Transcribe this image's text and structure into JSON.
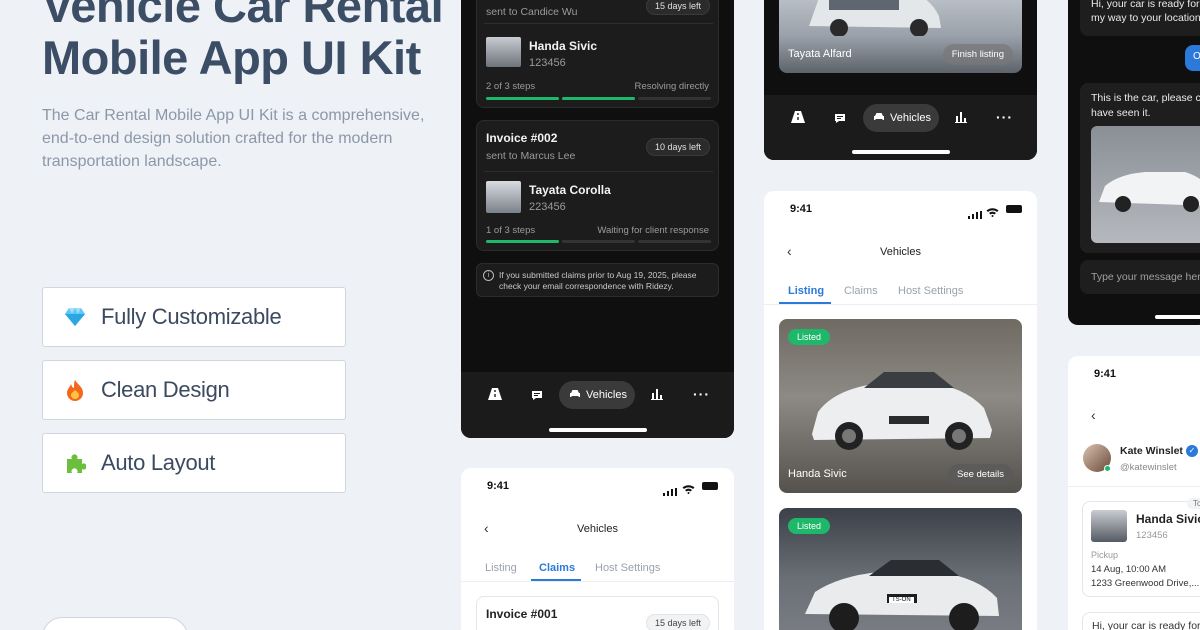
{
  "hero": {
    "title": "Vehicle Car Rental Mobile App UI Kit",
    "description": "The Car Rental Mobile App UI Kit is a comprehensive, end-to-end design solution crafted for the modern transportation landscape."
  },
  "features": [
    {
      "label": "Fully Customizable",
      "icon": "diamond-icon"
    },
    {
      "label": "Clean Design",
      "icon": "fire-icon"
    },
    {
      "label": "Auto Layout",
      "icon": "puzzle-icon"
    }
  ],
  "claims_dark": {
    "invoice1": {
      "sent_to": "sent to Candice Wu",
      "badge": "15 days left",
      "car_name": "Handa Sivic",
      "car_id": "123456",
      "steps": "2 of 3 steps",
      "status": "Resolving directly"
    },
    "invoice2": {
      "title": "Invoice #002",
      "sent_to": "sent to Marcus Lee",
      "badge": "10 days left",
      "car_name": "Tayata Corolla",
      "car_id": "223456",
      "steps": "1 of 3 steps",
      "status": "Waiting for client response"
    },
    "notice": "If you submitted claims prior to Aug 19, 2025, please check your email correspondence with Ridezy.",
    "nav": {
      "active": "Vehicles"
    }
  },
  "listing_dark": {
    "car_name": "Tayata Alfard",
    "finish_label": "Finish listing",
    "nav": {
      "active": "Vehicles"
    }
  },
  "vehicles_listing": {
    "time": "9:41",
    "title": "Vehicles",
    "tabs": [
      "Listing",
      "Claims",
      "Host Settings"
    ],
    "active_tab": "Listing",
    "cards": [
      {
        "badge": "Listed",
        "name": "Handa Sivic",
        "action": "See details"
      },
      {
        "badge": "Listed",
        "plate": "TS-ON"
      }
    ]
  },
  "vehicles_claims": {
    "time": "9:41",
    "title": "Vehicles",
    "tabs": [
      "Listing",
      "Claims",
      "Host Settings"
    ],
    "active_tab": "Claims",
    "invoice": {
      "title": "Invoice #001",
      "badge": "15 days left"
    }
  },
  "chat_dark": {
    "msg1": "Hi, your car is ready for my way to your location",
    "msg1_line1": "Hi, your car is ready for",
    "msg1_line2": "my way to your location",
    "msg2_line1": "This is the car, please c",
    "msg2_line2": "have seen it.",
    "placeholder": "Type your message her"
  },
  "chat_light": {
    "time": "9:41",
    "user_name": "Kate Winslet",
    "user_handle": "@katewinslet",
    "booking_tag": "To",
    "car_name": "Handa Sivic",
    "car_id": "123456",
    "pickup_label": "Pickup",
    "pickup_date": "14 Aug, 10:00 AM",
    "pickup_address": "1233 Greenwood Drive,...",
    "msg": "Hi, your car is ready for"
  },
  "colors": {
    "accent": "#2b79d8",
    "success": "#1fb86a",
    "progress": "#1fb86a",
    "dark_bg": "#0f0f0f"
  }
}
